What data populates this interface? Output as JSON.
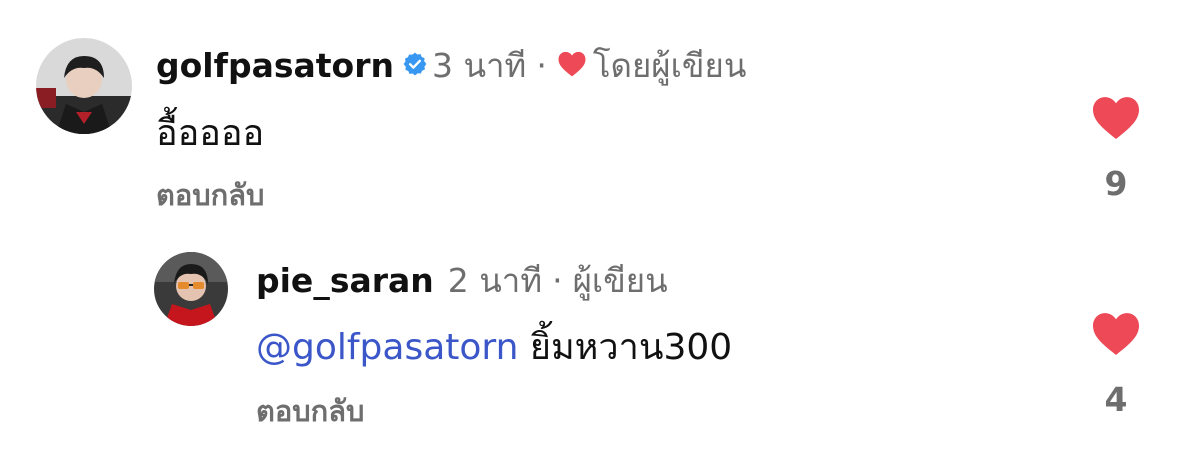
{
  "comments": [
    {
      "username": "golfpasatorn",
      "verified": true,
      "time": "3 นาที",
      "separator": "·",
      "author_badge": "โดยผู้เขียน",
      "text": "อื้ออออ",
      "reply_label": "ตอบกลับ",
      "likes": "9"
    },
    {
      "username": "pie_saran",
      "time": "2 นาที",
      "separator": "·",
      "author_badge": "ผู้เขียน",
      "mention": "@golfpasatorn",
      "text": "ยิ้มหวาน300",
      "reply_label": "ตอบกลับ",
      "likes": "4"
    }
  ],
  "colors": {
    "like_heart": "#ed4956",
    "verified_badge": "#3897f0",
    "mention": "#3a56c9",
    "meta_text": "#6e6e6e"
  },
  "icons": {
    "like": "heart-icon",
    "verified": "verified-badge-icon",
    "author_like": "heart-icon"
  }
}
